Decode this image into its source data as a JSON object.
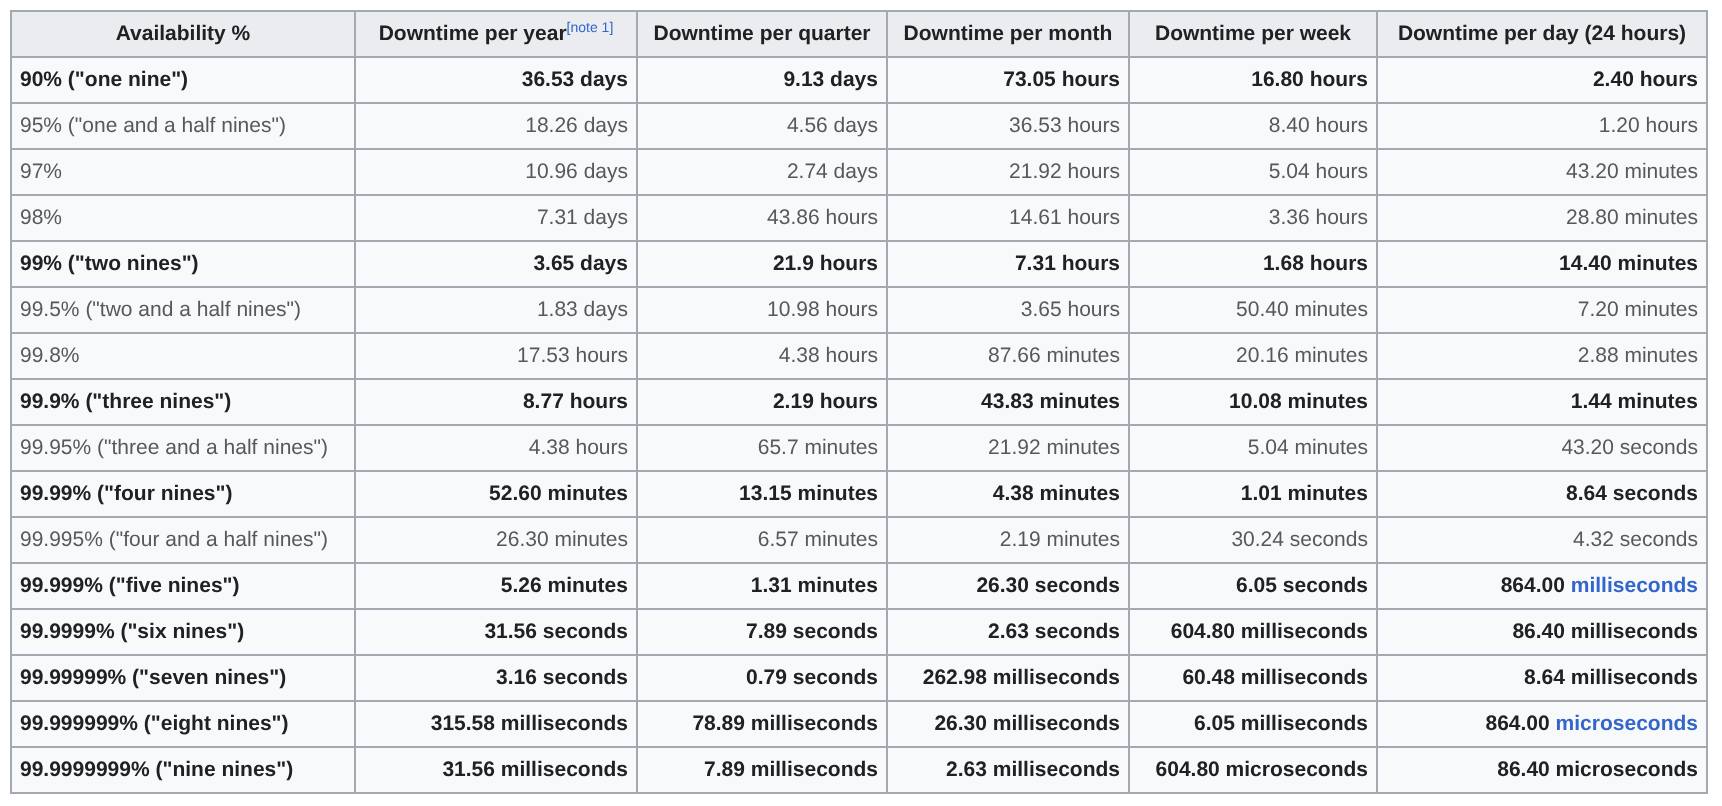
{
  "table": {
    "columns": [
      {
        "label": "Availability %"
      },
      {
        "label": "Downtime per year",
        "note": "[note 1]"
      },
      {
        "label": "Downtime per quarter"
      },
      {
        "label": "Downtime per month"
      },
      {
        "label": "Downtime per week"
      },
      {
        "label": "Downtime per day (24 hours)"
      }
    ],
    "rows": [
      {
        "bold": true,
        "cells": [
          "90% (\"one nine\")",
          "36.53 days",
          "9.13 days",
          "73.05 hours",
          "16.80 hours",
          "2.40 hours"
        ]
      },
      {
        "bold": false,
        "cells": [
          "95% (\"one and a half nines\")",
          "18.26 days",
          "4.56 days",
          "36.53 hours",
          "8.40 hours",
          "1.20 hours"
        ]
      },
      {
        "bold": false,
        "cells": [
          "97%",
          "10.96 days",
          "2.74 days",
          "21.92 hours",
          "5.04 hours",
          "43.20 minutes"
        ]
      },
      {
        "bold": false,
        "cells": [
          "98%",
          "7.31 days",
          "43.86 hours",
          "14.61 hours",
          "3.36 hours",
          "28.80 minutes"
        ]
      },
      {
        "bold": true,
        "cells": [
          "99% (\"two nines\")",
          "3.65 days",
          "21.9 hours",
          "7.31 hours",
          "1.68 hours",
          "14.40 minutes"
        ]
      },
      {
        "bold": false,
        "cells": [
          "99.5% (\"two and a half nines\")",
          "1.83 days",
          "10.98 hours",
          "3.65 hours",
          "50.40 minutes",
          "7.20 minutes"
        ]
      },
      {
        "bold": false,
        "cells": [
          "99.8%",
          "17.53 hours",
          "4.38 hours",
          "87.66 minutes",
          "20.16 minutes",
          "2.88 minutes"
        ]
      },
      {
        "bold": true,
        "cells": [
          "99.9% (\"three nines\")",
          "8.77 hours",
          "2.19 hours",
          "43.83 minutes",
          "10.08 minutes",
          "1.44 minutes"
        ]
      },
      {
        "bold": false,
        "cells": [
          "99.95% (\"three and a half nines\")",
          "4.38 hours",
          "65.7 minutes",
          "21.92 minutes",
          "5.04 minutes",
          "43.20 seconds"
        ]
      },
      {
        "bold": true,
        "cells": [
          "99.99% (\"four nines\")",
          "52.60 minutes",
          "13.15 minutes",
          "4.38 minutes",
          "1.01 minutes",
          "8.64 seconds"
        ]
      },
      {
        "bold": false,
        "cells": [
          "99.995% (\"four and a half nines\")",
          "26.30 minutes",
          "6.57 minutes",
          "2.19 minutes",
          "30.24 seconds",
          "4.32 seconds"
        ]
      },
      {
        "bold": true,
        "cells": [
          "99.999% (\"five nines\")",
          "5.26 minutes",
          "1.31 minutes",
          "26.30 seconds",
          "6.05 seconds",
          {
            "text": "864.00",
            "link": "milliseconds"
          }
        ]
      },
      {
        "bold": true,
        "cells": [
          "99.9999% (\"six nines\")",
          "31.56 seconds",
          "7.89 seconds",
          "2.63 seconds",
          "604.80 milliseconds",
          "86.40 milliseconds"
        ]
      },
      {
        "bold": true,
        "cells": [
          "99.99999% (\"seven nines\")",
          "3.16 seconds",
          "0.79 seconds",
          "262.98 milliseconds",
          "60.48 milliseconds",
          "8.64 milliseconds"
        ]
      },
      {
        "bold": true,
        "cells": [
          "99.999999% (\"eight nines\")",
          "315.58 milliseconds",
          "78.89 milliseconds",
          "26.30 milliseconds",
          "6.05 milliseconds",
          {
            "text": "864.00",
            "link": "microseconds"
          }
        ]
      },
      {
        "bold": true,
        "cells": [
          "99.9999999% (\"nine nines\")",
          "31.56 milliseconds",
          "7.89 milliseconds",
          "2.63 milliseconds",
          "604.80 microseconds",
          "86.40 microseconds"
        ]
      }
    ]
  }
}
